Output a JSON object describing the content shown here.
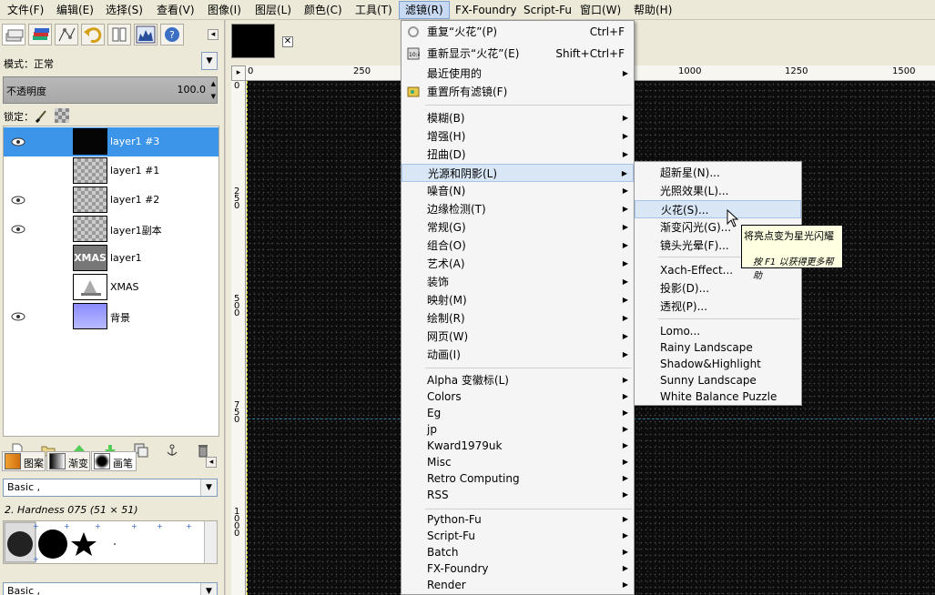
{
  "menubar": [
    "文件(F)",
    "编辑(E)",
    "选择(S)",
    "查看(V)",
    "图像(I)",
    "图层(L)",
    "颜色(C)",
    "工具(T)",
    "滤镜(R)",
    "FX-Foundry",
    "Script-Fu",
    "窗口(W)",
    "帮助(H)"
  ],
  "layers_panel": {
    "mode_label": "模式：",
    "mode_value": "正常",
    "opacity_label": "不透明度",
    "opacity_value": "100.0",
    "lock_label": "锁定：",
    "layers": [
      {
        "name": "layer1 #3",
        "visible": true,
        "selected": true
      },
      {
        "name": "layer1 #1",
        "visible": false,
        "selected": false
      },
      {
        "name": "layer1 #2",
        "visible": true,
        "selected": false
      },
      {
        "name": "layer1副本",
        "visible": true,
        "selected": false
      },
      {
        "name": "layer1",
        "visible": false,
        "selected": false,
        "thumb_text": "XMAS"
      },
      {
        "name": "XMAS",
        "visible": false,
        "selected": false
      },
      {
        "name": "背景",
        "visible": true,
        "selected": false
      }
    ]
  },
  "brush_panel": {
    "tabs": [
      "图案",
      "渐变",
      "画笔"
    ],
    "preset_top": "Basic ,",
    "brush_name": "2. Hardness 075 (51 × 51)",
    "preset_bottom": "Basic ,"
  },
  "ruler": {
    "h_labels": [
      "0",
      "250",
      "1000",
      "1250",
      "1500"
    ],
    "v_labels": [
      "0",
      "250",
      "500",
      "750",
      "1000"
    ]
  },
  "filters_menu": {
    "top": [
      {
        "label": "重复“火花”(P)",
        "shortcut": "Ctrl+F"
      },
      {
        "label": "重新显示“火花”(E)",
        "shortcut": "Shift+Ctrl+F"
      },
      {
        "label": "最近使用的",
        "shortcut": ""
      },
      {
        "label": "重置所有滤镜(F)",
        "shortcut": ""
      }
    ],
    "group1": [
      "模糊(B)",
      "增强(H)",
      "扭曲(D)",
      "光源和阴影(L)",
      "噪音(N)",
      "边缘检测(T)",
      "常规(G)",
      "组合(O)",
      "艺术(A)",
      "装饰",
      "映射(M)",
      "绘制(R)",
      "网页(W)",
      "动画(I)"
    ],
    "group2": [
      "Alpha 变徽标(L)",
      "Colors",
      "Eg",
      "jp",
      "Kward1979uk",
      "Misc",
      "Retro Computing",
      "RSS"
    ],
    "group3": [
      "Python-Fu",
      "Script-Fu",
      "Batch",
      "FX-Foundry",
      "Render"
    ]
  },
  "light_shadow_submenu": {
    "group1": [
      "超新星(N)...",
      "光照效果(L)...",
      "火花(S)...",
      "渐变闪光(G)...",
      "镜头光晕(F)..."
    ],
    "group2": [
      "Xach-Effect...",
      "投影(D)...",
      "透视(P)..."
    ],
    "group3": [
      "Lomo...",
      "Rainy Landscape",
      "Shadow&Highlight",
      "Sunny Landscape",
      "White Balance Puzzle"
    ]
  },
  "tooltip": {
    "line1": "将亮点变为星光闪耀",
    "line2": "按 F1 以获得更多帮助"
  }
}
